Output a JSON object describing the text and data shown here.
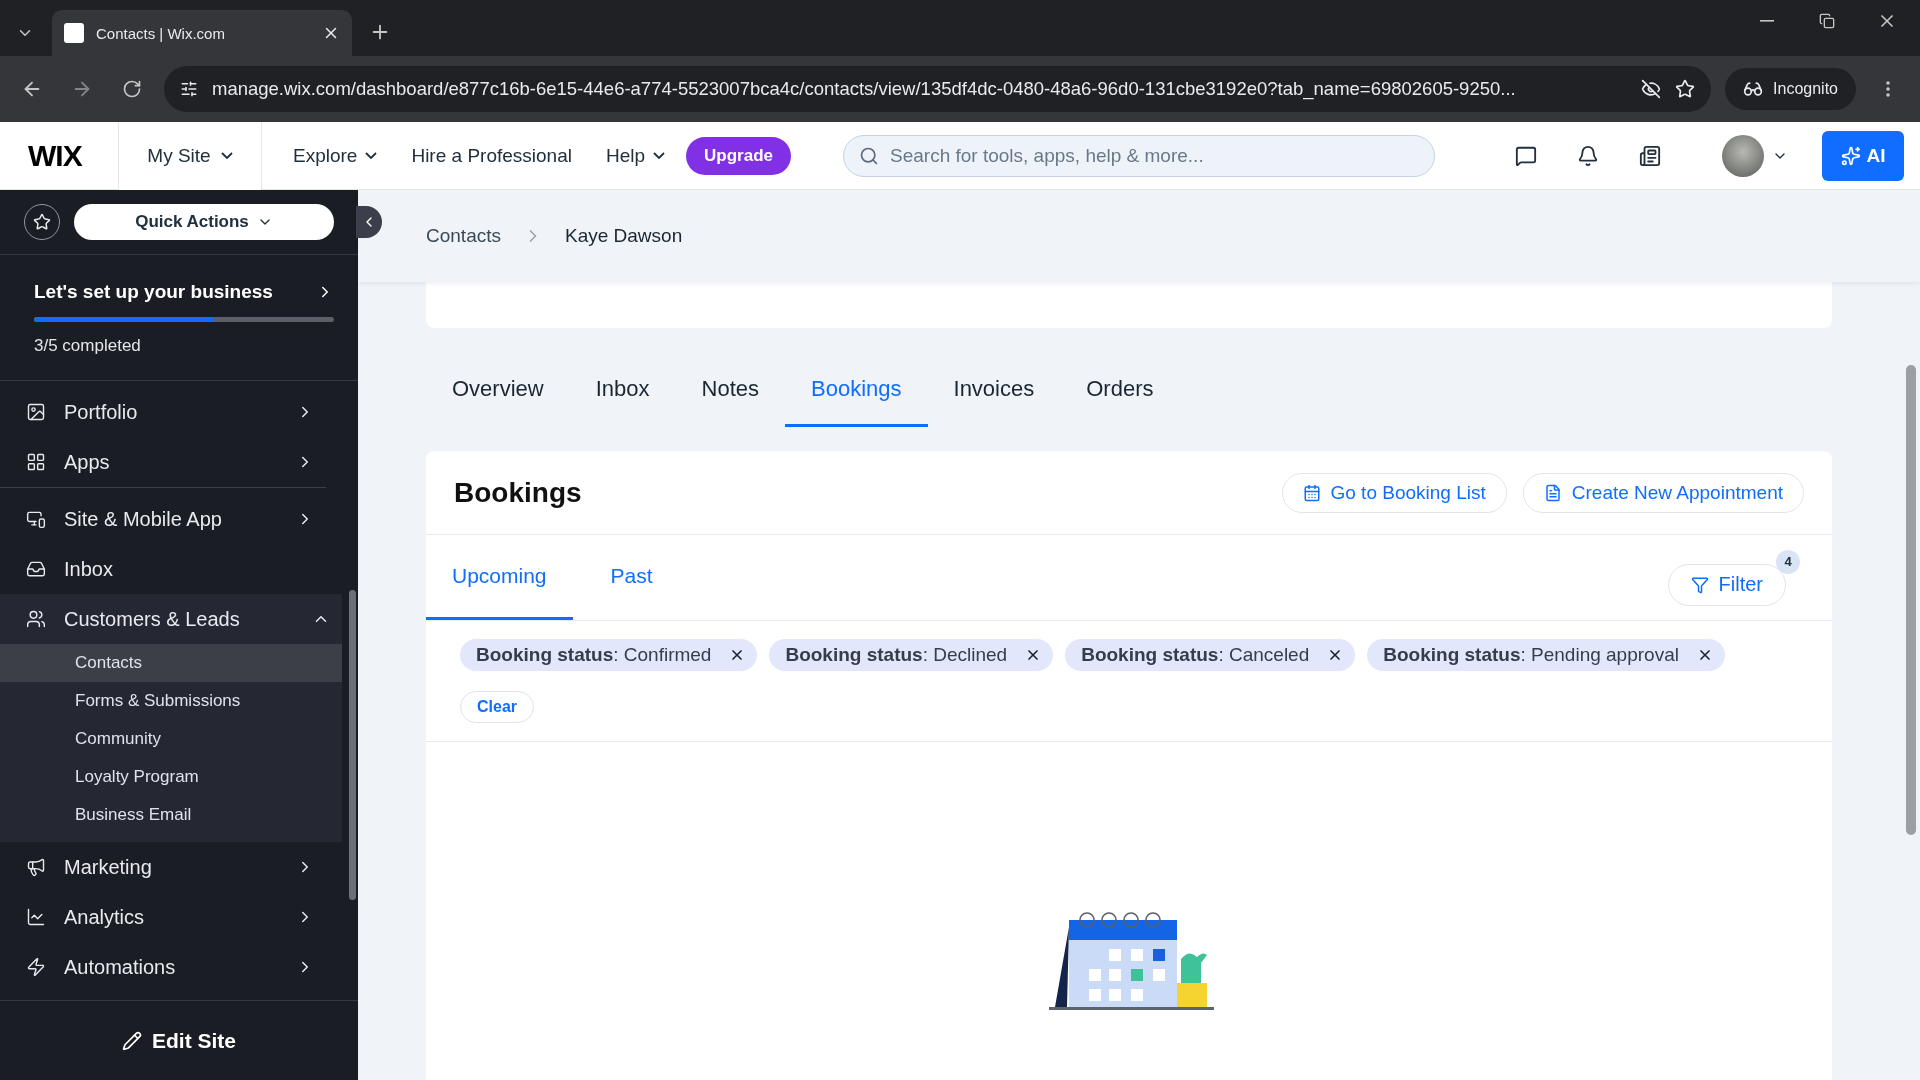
{
  "browser": {
    "tab_title": "Contacts | Wix.com",
    "url": "manage.wix.com/dashboard/e877c16b-6e15-44e6-a774-5523007bca4c/contacts/view/135df4dc-0480-48a6-96d0-131cbe3192e0?tab_name=69802605-9250...",
    "profile": "Incognito"
  },
  "topbar": {
    "logo": "WIX",
    "site_menu": "My Site",
    "nav": [
      "Explore",
      "Hire a Professional",
      "Help"
    ],
    "nav_dropdown": [
      true,
      false,
      true
    ],
    "upgrade": "Upgrade",
    "search": {
      "placeholder": "Search for tools, apps, help & more..."
    },
    "ai": "AI"
  },
  "sidebar": {
    "quick_actions": "Quick Actions",
    "setup": {
      "title": "Let's set up your business",
      "level": 0.6,
      "progress": "3/5 completed"
    },
    "groups": [
      [
        {
          "kind": "section",
          "label": "Portfolio",
          "expanded": false
        },
        {
          "kind": "section",
          "label": "Apps",
          "expanded": false
        }
      ],
      [
        {
          "kind": "section",
          "label": "Site & Mobile App",
          "expanded": false
        },
        {
          "kind": "link",
          "label": "Inbox"
        },
        {
          "kind": "section",
          "label": "Customers & Leads",
          "expanded": true,
          "children": [
            {
              "label": "Contacts",
              "selected": true
            },
            {
              "label": "Forms & Submissions",
              "selected": false
            },
            {
              "label": "Community",
              "selected": false
            },
            {
              "label": "Loyalty Program",
              "selected": false
            },
            {
              "label": "Business Email",
              "selected": false
            }
          ]
        },
        {
          "kind": "section",
          "label": "Marketing",
          "expanded": false
        },
        {
          "kind": "section",
          "label": "Analytics",
          "expanded": false
        },
        {
          "kind": "section",
          "label": "Automations",
          "expanded": false
        }
      ]
    ],
    "edit_site": "Edit Site"
  },
  "breadcrumb": [
    "Contacts",
    "Kaye Dawson"
  ],
  "tabs": [
    {
      "label": "Overview",
      "selected": false
    },
    {
      "label": "Inbox",
      "selected": false
    },
    {
      "label": "Notes",
      "selected": false
    },
    {
      "label": "Bookings",
      "selected": true
    },
    {
      "label": "Invoices",
      "selected": false
    },
    {
      "label": "Orders",
      "selected": false
    }
  ],
  "bookings": {
    "title": "Bookings",
    "actions": [
      "Go to Booking List",
      "Create New Appointment"
    ],
    "subtabs": [
      {
        "label": "Upcoming",
        "selected": true
      },
      {
        "label": "Past",
        "selected": false
      }
    ],
    "filter": {
      "label": "Filter",
      "count": "4"
    },
    "chips": [
      {
        "text": "**Booking status**: Confirmed"
      },
      {
        "text": "**Booking status**: Declined"
      },
      {
        "text": "**Booking status**: Canceled"
      },
      {
        "text": "**Booking status**: Pending approval"
      }
    ],
    "clear": "Clear"
  }
}
